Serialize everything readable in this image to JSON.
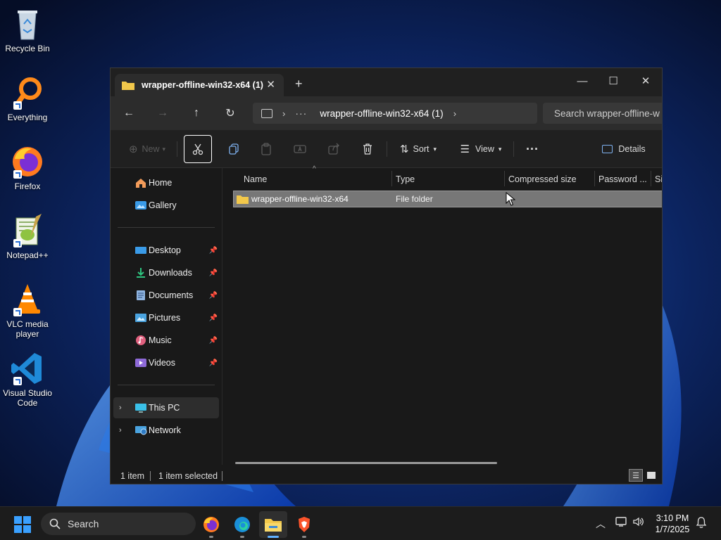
{
  "desktop": {
    "icons": [
      {
        "label": "Recycle Bin",
        "icon": "recycle-bin-icon"
      },
      {
        "label": "Everything",
        "icon": "magnifier-icon"
      },
      {
        "label": "Firefox",
        "icon": "firefox-icon"
      },
      {
        "label": "Notepad++",
        "icon": "notepad-plus-plus-icon"
      },
      {
        "label": "VLC media player",
        "icon": "vlc-cone-icon"
      },
      {
        "label": "Visual Studio Code",
        "icon": "vscode-icon"
      }
    ]
  },
  "window": {
    "tab_title": "wrapper-offline-win32-x64 (1)",
    "tab_close": "✕",
    "new_tab": "+",
    "controls": {
      "minimize": "—",
      "maximize": "☐",
      "close": "✕"
    }
  },
  "navigation": {
    "back": "←",
    "forward": "→",
    "up": "↑",
    "refresh": "↻",
    "address": {
      "ellipsis": "···",
      "current": "wrapper-offline-win32-x64 (1)"
    },
    "search_placeholder": "Search wrapper-offline-w"
  },
  "toolbar": {
    "new_label": "New",
    "sort_label": "Sort",
    "view_label": "View",
    "more": "···",
    "details_label": "Details"
  },
  "sidebar": {
    "top": [
      {
        "label": "Home",
        "icon": "home-icon"
      },
      {
        "label": "Gallery",
        "icon": "gallery-icon"
      }
    ],
    "quick_access": [
      {
        "label": "Desktop",
        "icon": "desktop-icon",
        "color": "#3a9be8"
      },
      {
        "label": "Downloads",
        "icon": "downloads-icon",
        "color": "#2ec27e"
      },
      {
        "label": "Documents",
        "icon": "documents-icon",
        "color": "#8fb4e0"
      },
      {
        "label": "Pictures",
        "icon": "pictures-icon",
        "color": "#4aa3df"
      },
      {
        "label": "Music",
        "icon": "music-icon",
        "color": "#e0607e"
      },
      {
        "label": "Videos",
        "icon": "videos-icon",
        "color": "#8e6ad8"
      }
    ],
    "locations": [
      {
        "label": "This PC",
        "icon": "this-pc-icon",
        "selected": true
      },
      {
        "label": "Network",
        "icon": "network-icon",
        "selected": false
      }
    ]
  },
  "columns": [
    "Name",
    "Type",
    "Compressed size",
    "Password ...",
    "Si"
  ],
  "files": [
    {
      "name": "wrapper-offline-win32-x64",
      "type": "File folder",
      "selected": true
    }
  ],
  "status": {
    "count": "1 item",
    "selection": "1 item selected"
  },
  "taskbar": {
    "search_label": "Search",
    "apps": [
      "firefox-icon",
      "edge-icon",
      "file-explorer-icon",
      "brave-icon"
    ],
    "time": "3:10 PM",
    "date": "1/7/2025"
  },
  "colors": {
    "folder": "#f2c84b",
    "accent": "#60b0ff"
  }
}
